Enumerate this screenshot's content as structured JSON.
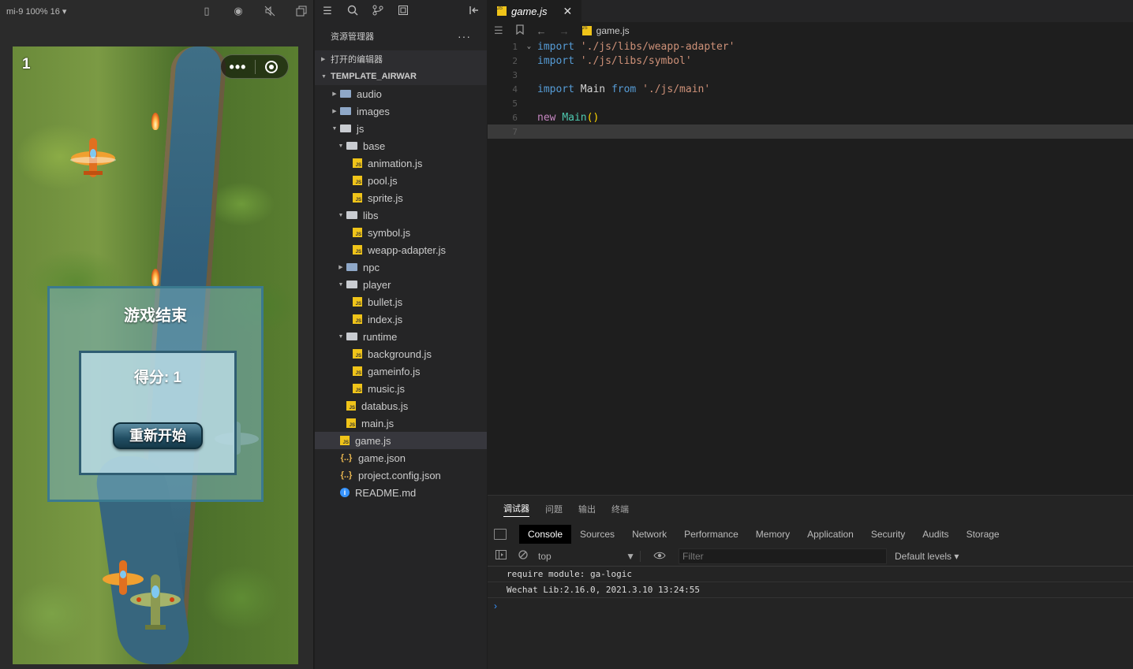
{
  "simulator": {
    "device_label": "mi-9 100% 16 ▾",
    "game": {
      "corner_score": "1",
      "over_title": "游戏结束",
      "over_score": "得分: 1",
      "restart_label": "重新开始"
    }
  },
  "explorer": {
    "title": "资源管理器",
    "more": "···",
    "open_editors": "打开的编辑器",
    "project": "TEMPLATE_AIRWAR",
    "items": [
      {
        "label": "audio",
        "type": "folder",
        "depth": 0,
        "expanded": false
      },
      {
        "label": "images",
        "type": "folder",
        "depth": 0,
        "expanded": false
      },
      {
        "label": "js",
        "type": "folder",
        "depth": 0,
        "expanded": true
      },
      {
        "label": "base",
        "type": "folder",
        "depth": 1,
        "expanded": true
      },
      {
        "label": "animation.js",
        "type": "js",
        "depth": 2
      },
      {
        "label": "pool.js",
        "type": "js",
        "depth": 2
      },
      {
        "label": "sprite.js",
        "type": "js",
        "depth": 2
      },
      {
        "label": "libs",
        "type": "folder",
        "depth": 1,
        "expanded": true
      },
      {
        "label": "symbol.js",
        "type": "js",
        "depth": 2
      },
      {
        "label": "weapp-adapter.js",
        "type": "js",
        "depth": 2
      },
      {
        "label": "npc",
        "type": "folder",
        "depth": 1,
        "expanded": false
      },
      {
        "label": "player",
        "type": "folder",
        "depth": 1,
        "expanded": true
      },
      {
        "label": "bullet.js",
        "type": "js",
        "depth": 2
      },
      {
        "label": "index.js",
        "type": "js",
        "depth": 2
      },
      {
        "label": "runtime",
        "type": "folder",
        "depth": 1,
        "expanded": true
      },
      {
        "label": "background.js",
        "type": "js",
        "depth": 2
      },
      {
        "label": "gameinfo.js",
        "type": "js",
        "depth": 2
      },
      {
        "label": "music.js",
        "type": "js",
        "depth": 2
      },
      {
        "label": "databus.js",
        "type": "js",
        "depth": 1
      },
      {
        "label": "main.js",
        "type": "js",
        "depth": 1
      },
      {
        "label": "game.js",
        "type": "js",
        "depth": 0,
        "selected": true
      },
      {
        "label": "game.json",
        "type": "json",
        "depth": 0
      },
      {
        "label": "project.config.json",
        "type": "json",
        "depth": 0
      },
      {
        "label": "README.md",
        "type": "info",
        "depth": 0
      }
    ]
  },
  "editor": {
    "tab_label": "game.js",
    "tab_close": "✕",
    "breadcrumb_file": "game.js",
    "lines": [
      {
        "n": "1",
        "tokens": [
          [
            "kw",
            "import"
          ],
          [
            "plain",
            " "
          ],
          [
            "str",
            "'./js/libs/weapp-adapter'"
          ]
        ]
      },
      {
        "n": "2",
        "tokens": [
          [
            "kw",
            "import"
          ],
          [
            "plain",
            " "
          ],
          [
            "str",
            "'./js/libs/symbol'"
          ]
        ]
      },
      {
        "n": "3",
        "tokens": []
      },
      {
        "n": "4",
        "tokens": [
          [
            "kw",
            "import"
          ],
          [
            "plain",
            " Main "
          ],
          [
            "kw",
            "from"
          ],
          [
            "plain",
            " "
          ],
          [
            "str",
            "'./js/main'"
          ]
        ]
      },
      {
        "n": "5",
        "tokens": []
      },
      {
        "n": "6",
        "tokens": [
          [
            "kw2",
            "new"
          ],
          [
            "plain",
            " "
          ],
          [
            "fn",
            "Main"
          ],
          [
            "par",
            "()"
          ]
        ]
      },
      {
        "n": "7",
        "tokens": []
      }
    ]
  },
  "panel": {
    "tabs": [
      "调试器",
      "问题",
      "输出",
      "终端"
    ],
    "devtools_tabs": [
      "Console",
      "Sources",
      "Network",
      "Performance",
      "Memory",
      "Application",
      "Security",
      "Audits",
      "Storage"
    ],
    "context": "top",
    "filter_placeholder": "Filter",
    "levels": "Default levels ▾",
    "logs": [
      "require module: ga-logic",
      "Wechat Lib:2.16.0, 2021.3.10 13:24:55"
    ],
    "prompt": "›"
  }
}
